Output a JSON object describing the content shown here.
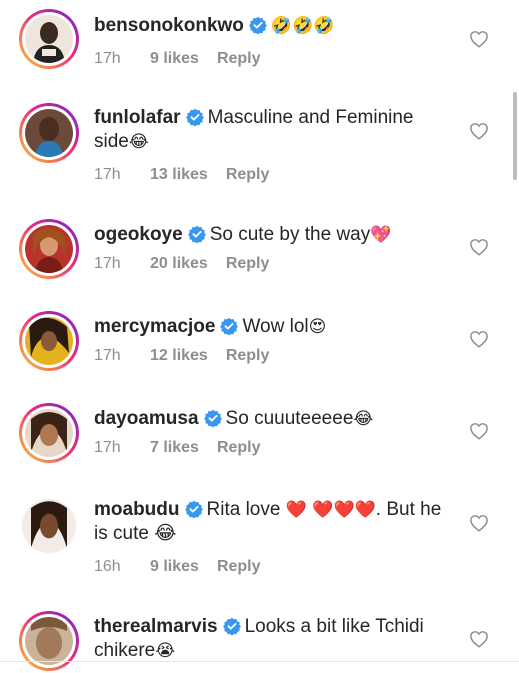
{
  "comments": [
    {
      "username": "bensonokonkwo",
      "text_before": "",
      "emojis": "🤣🤣🤣",
      "text_after": "",
      "time": "17h",
      "likes": "9 likes",
      "reply": "Reply",
      "avatar_color": "#2b2b2b"
    },
    {
      "username": "funlolafar",
      "text_before": "Masculine and Feminine side",
      "emojis": "😂",
      "text_after": "",
      "time": "17h",
      "likes": "13 likes",
      "reply": "Reply",
      "avatar_color": "#3a2a22"
    },
    {
      "username": "ogeokoye",
      "text_before": "So cute by the way",
      "emojis": "💖",
      "text_after": "",
      "time": "17h",
      "likes": "20 likes",
      "reply": "Reply",
      "avatar_color": "#c0392b"
    },
    {
      "username": "mercymacjoe",
      "text_before": "Wow lol",
      "emojis": "😍",
      "text_after": "",
      "time": "17h",
      "likes": "12 likes",
      "reply": "Reply",
      "avatar_color": "#d4a017"
    },
    {
      "username": "dayoamusa",
      "text_before": "So cuuuteeeee",
      "emojis": "😂",
      "text_after": "",
      "time": "17h",
      "likes": "7 likes",
      "reply": "Reply",
      "avatar_color": "#8e5a3c"
    },
    {
      "username": "moabudu",
      "text_before": "Rita love ",
      "emojis": "❤️ ❤️❤️❤️",
      "text_after": ". But he is cute 😂",
      "time": "16h",
      "likes": "9 likes",
      "reply": "Reply",
      "avatar_color": "#4a3020"
    },
    {
      "username": "therealmarvis",
      "text_before": "Looks a bit like Tchidi chikere",
      "emojis": "😭",
      "text_after": "",
      "time": "",
      "likes": "",
      "reply": "",
      "avatar_color": "#a88a6a"
    }
  ],
  "colors": {
    "verified_badge": "#3897f0",
    "meta_text": "#8e8e8e",
    "primary_text": "#262626",
    "emoji_red": "#e0245e"
  },
  "icons": {
    "verified": "verified-badge-icon",
    "like": "heart-outline-icon"
  }
}
